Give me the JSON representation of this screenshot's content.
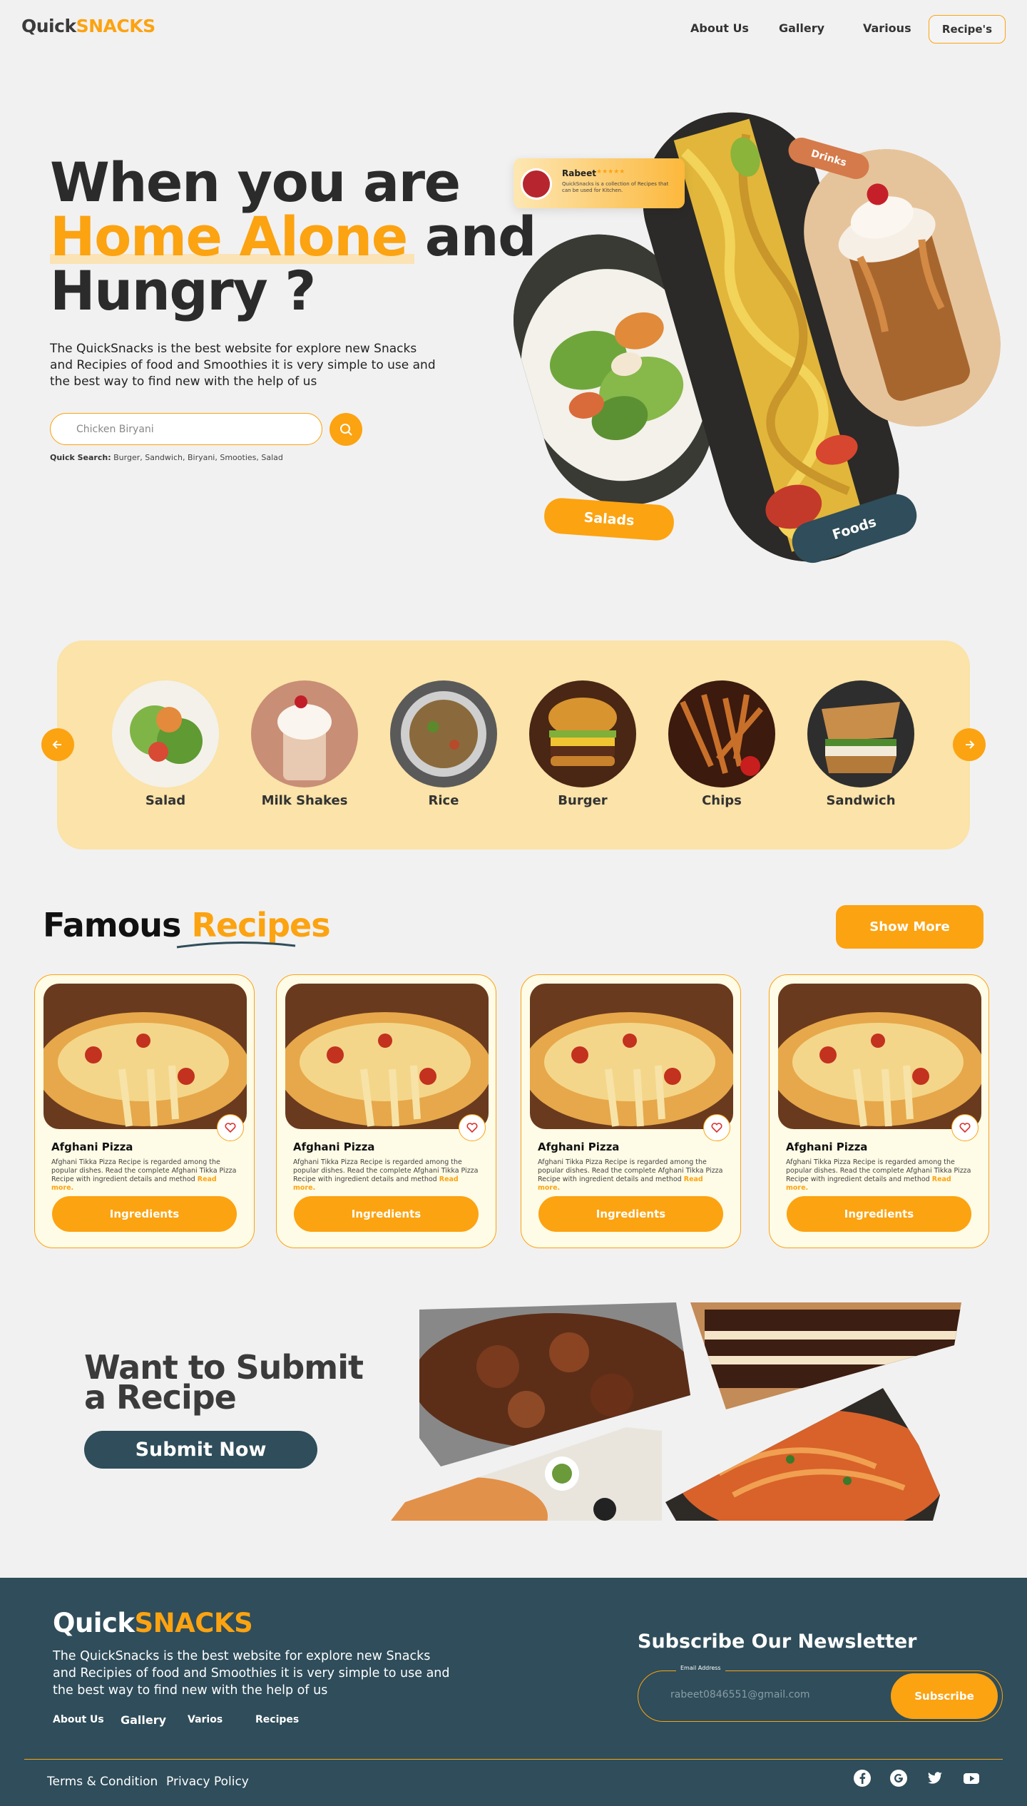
{
  "header": {
    "logo_a": "Quick",
    "logo_b": "SNACKS",
    "nav": [
      "About Us",
      "Gallery",
      "Various"
    ],
    "cta": "Recipe's"
  },
  "hero": {
    "line1": "When you are",
    "line2_highlight": "Home Alone",
    "line2_rest": "and",
    "line3": "Hungry ?",
    "paragraph": "The QuickSnacks is the best website for explore new Snacks and Recipies of food and Smoothies it is very simple to use and the best way to find new with the help of us",
    "search_placeholder": "Chicken Biryani",
    "quick_label": "Quick Search:",
    "quick_items": "Burger, Sandwich, Biryani, Smooties, Salad",
    "review": {
      "name": "Rabeet",
      "stars": "★★★★★",
      "text": "QuickSnacks is a collection of Recipes that can be used for Kitchen."
    },
    "tags": {
      "salads": "Salads",
      "foods": "Foods",
      "drinks": "Drinks"
    }
  },
  "categories": [
    {
      "label": "Salad"
    },
    {
      "label": "Milk Shakes"
    },
    {
      "label": "Rice"
    },
    {
      "label": "Burger"
    },
    {
      "label": "Chips"
    },
    {
      "label": "Sandwich"
    }
  ],
  "famous": {
    "title_a": "Famous",
    "title_b": "Recipes",
    "show_more": "Show More",
    "cards": [
      {
        "title": "Afghani Pizza",
        "desc": "Afghani Tikka Pizza Recipe is regarded among the popular dishes. Read the complete Afghani Tikka Pizza Recipe with ingredient details and method",
        "read_more": "Read more.",
        "button": "Ingredients"
      },
      {
        "title": "Afghani Pizza",
        "desc": "Afghani Tikka Pizza Recipe is regarded among the popular dishes. Read the complete Afghani Tikka Pizza Recipe with ingredient details and method",
        "read_more": "Read more.",
        "button": "Ingredients"
      },
      {
        "title": "Afghani Pizza",
        "desc": "Afghani Tikka Pizza Recipe is regarded among the popular dishes. Read the complete Afghani Tikka Pizza Recipe with ingredient details and method",
        "read_more": "Read more.",
        "button": "Ingredients"
      },
      {
        "title": "Afghani Pizza",
        "desc": "Afghani Tikka Pizza Recipe is regarded among the popular dishes. Read the complete Afghani Tikka Pizza Recipe with ingredient details and method",
        "read_more": "Read more.",
        "button": "Ingredients"
      }
    ]
  },
  "submit": {
    "line1": "Want to Submit",
    "line2": "a Recipe",
    "button": "Submit Now"
  },
  "footer": {
    "logo_a": "Quick",
    "logo_b": "SNACKS",
    "paragraph": "The QuickSnacks is the best website for explore new Snacks and Recipies of food and Smoothies it is very simple to use and the best way to find new with the help of us",
    "links": [
      "About Us",
      "Gallery",
      "Varios",
      "Recipes"
    ],
    "newsletter_title": "Subscribe Our Newsletter",
    "email_label": "Email Address",
    "email_value": "rabeet0846551@gmail.com",
    "subscribe": "Subscribe",
    "terms": "Terms & Condition",
    "privacy": "Privacy Policy",
    "social_icons": [
      "facebook-icon",
      "google-icon",
      "twitter-icon",
      "youtube-icon"
    ]
  },
  "colors": {
    "accent": "#fca311",
    "dark": "#2f4d5a",
    "panel": "#fbe3a9",
    "card_bg": "#fefbe6",
    "page_bg": "#f1f1f1"
  }
}
